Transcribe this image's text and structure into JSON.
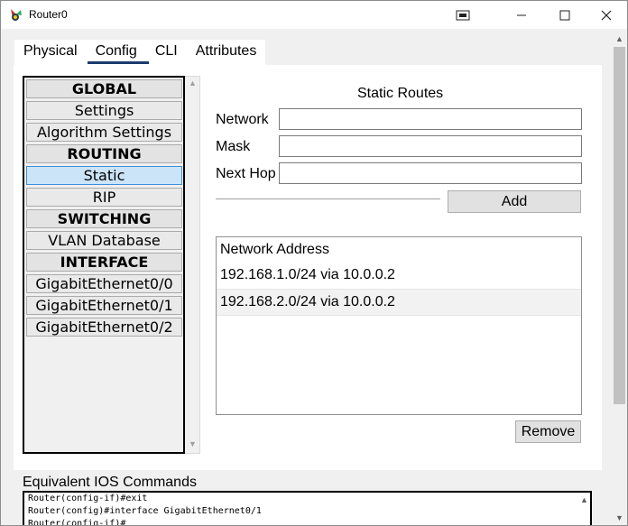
{
  "window": {
    "title": "Router0",
    "icons": [
      "router-app-icon",
      "restore-icon",
      "minimize-icon",
      "maximize-icon",
      "close-icon"
    ]
  },
  "tabs": [
    {
      "label": "Physical"
    },
    {
      "label": "Config"
    },
    {
      "label": "CLI"
    },
    {
      "label": "Attributes"
    }
  ],
  "active_tab": "Config",
  "nav": {
    "items": [
      {
        "label": "GLOBAL",
        "kind": "header"
      },
      {
        "label": "Settings",
        "kind": "item"
      },
      {
        "label": "Algorithm Settings",
        "kind": "item"
      },
      {
        "label": "ROUTING",
        "kind": "header"
      },
      {
        "label": "Static",
        "kind": "item",
        "selected": true
      },
      {
        "label": "RIP",
        "kind": "item"
      },
      {
        "label": "SWITCHING",
        "kind": "header"
      },
      {
        "label": "VLAN Database",
        "kind": "item"
      },
      {
        "label": "INTERFACE",
        "kind": "header"
      },
      {
        "label": "GigabitEthernet0/0",
        "kind": "item"
      },
      {
        "label": "GigabitEthernet0/1",
        "kind": "item"
      },
      {
        "label": "GigabitEthernet0/2",
        "kind": "item"
      }
    ]
  },
  "static_routes": {
    "title": "Static Routes",
    "network_label": "Network",
    "network_value": "",
    "mask_label": "Mask",
    "mask_value": "",
    "next_hop_label": "Next Hop",
    "next_hop_value": "",
    "add_label": "Add",
    "list_header": "Network Address",
    "routes": [
      "192.168.1.0/24 via 10.0.0.2",
      "192.168.2.0/24 via 10.0.0.2"
    ],
    "remove_label": "Remove"
  },
  "ios": {
    "label": "Equivalent IOS Commands",
    "lines": [
      "Router(config-if)#exit",
      "Router(config)#interface GigabitEthernet0/1",
      "Router(config-if)#"
    ]
  },
  "colors": {
    "accent_underline": "#1a3c6e",
    "selected_bg": "#cce4f7",
    "selected_border": "#3e8ed3"
  }
}
